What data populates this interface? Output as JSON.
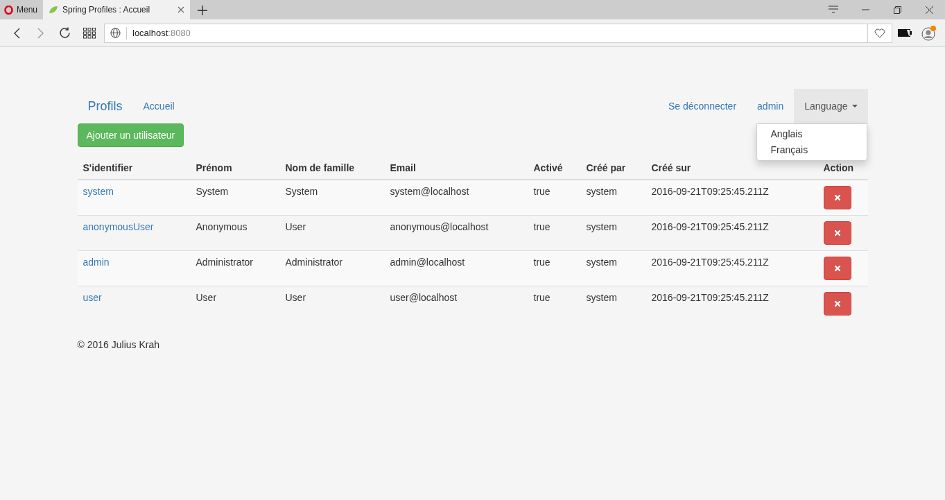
{
  "browser": {
    "menu_label": "Menu",
    "tabs": [
      {
        "title": "Spring Profiles : Accueil",
        "selected": true
      }
    ],
    "address": {
      "host": "localhost",
      "port": ":8080"
    }
  },
  "navbar": {
    "brand": "Profils",
    "left_links": [
      "Accueil"
    ],
    "right_links": [
      "Se déconnecter",
      "admin"
    ],
    "dropdown": {
      "label": "Language",
      "expanded": true,
      "items": [
        "Anglais",
        "Français"
      ]
    }
  },
  "add_button": "Ajouter un utilisateur",
  "table": {
    "columns": [
      "S'identifier",
      "Prénom",
      "Nom de famille",
      "Email",
      "Activé",
      "Créé par",
      "Créé sur",
      "Action"
    ],
    "rows": [
      {
        "login": "system",
        "first_name": "System",
        "last_name": "System",
        "email": "system@localhost",
        "activated": "true",
        "created_by": "system",
        "created_on": "2016-09-21T09:25:45.211Z"
      },
      {
        "login": "anonymousUser",
        "first_name": "Anonymous",
        "last_name": "User",
        "email": "anonymous@localhost",
        "activated": "true",
        "created_by": "system",
        "created_on": "2016-09-21T09:25:45.211Z"
      },
      {
        "login": "admin",
        "first_name": "Administrator",
        "last_name": "Administrator",
        "email": "admin@localhost",
        "activated": "true",
        "created_by": "system",
        "created_on": "2016-09-21T09:25:45.211Z"
      },
      {
        "login": "user",
        "first_name": "User",
        "last_name": "User",
        "email": "user@localhost",
        "activated": "true",
        "created_by": "system",
        "created_on": "2016-09-21T09:25:45.211Z"
      }
    ]
  },
  "footer": "© 2016 Julius Krah"
}
